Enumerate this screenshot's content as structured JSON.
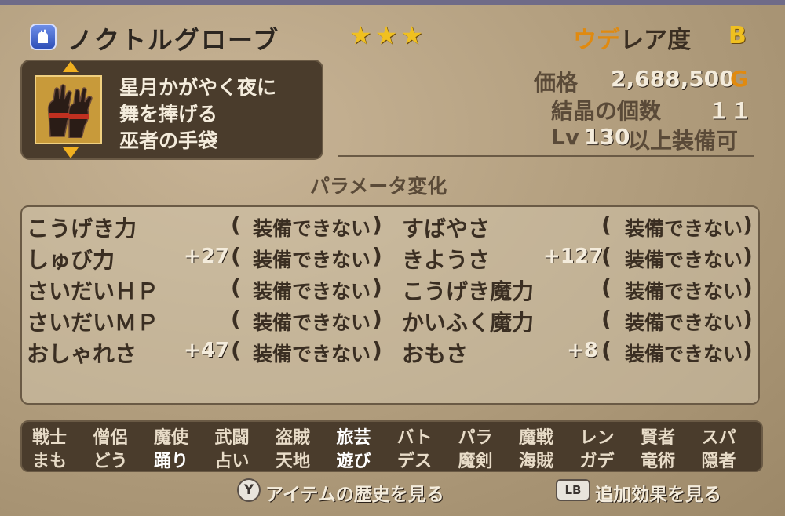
{
  "header": {
    "item_icon": "glove-icon",
    "item_name": "ノクトルグローブ",
    "stars": "★★★",
    "rarity_prefix": "ウデ",
    "rarity_label": "レア度",
    "rarity_grade": "B"
  },
  "description": {
    "lines": [
      "星月かがやく夜に",
      "舞を捧げる",
      "巫者の手袋"
    ]
  },
  "info": {
    "price_label": "価格",
    "price_value": "2,688,500",
    "price_unit": "G",
    "crystal_label": "結晶の個数",
    "crystal_value": "１１",
    "level_prefix": "Lv",
    "level_value": "130",
    "level_suffix": "以上装備可"
  },
  "params_title": "パラメータ変化",
  "params": {
    "left": [
      {
        "name": "こうげき力",
        "value": "",
        "status": "装備できない"
      },
      {
        "name": "しゅび力",
        "value": "+27",
        "status": "装備できない"
      },
      {
        "name": "さいだいＨＰ",
        "value": "",
        "status": "装備できない"
      },
      {
        "name": "さいだいＭＰ",
        "value": "",
        "status": "装備できない"
      },
      {
        "name": "おしゃれさ",
        "value": "+47",
        "status": "装備できない"
      }
    ],
    "right": [
      {
        "name": "すばやさ",
        "value": "",
        "status": "装備できない"
      },
      {
        "name": "きようさ",
        "value": "+127",
        "status": "装備できない"
      },
      {
        "name": "こうげき魔力",
        "value": "",
        "status": "装備できない"
      },
      {
        "name": "かいふく魔力",
        "value": "",
        "status": "装備できない"
      },
      {
        "name": "おもさ",
        "value": "+8",
        "status": "装備できない"
      }
    ]
  },
  "jobs": {
    "row1": [
      "戦士",
      "僧侶",
      "魔使",
      "武闘",
      "盗賊",
      "旅芸",
      "バト",
      "パラ",
      "魔戦",
      "レン",
      "賢者",
      "スパ"
    ],
    "row2": [
      "まも",
      "どう",
      "踊り",
      "占い",
      "天地",
      "遊び",
      "デス",
      "魔剣",
      "海賊",
      "ガデ",
      "竜術",
      "隠者"
    ],
    "row1_on": [
      false,
      false,
      false,
      false,
      false,
      true,
      false,
      false,
      false,
      false,
      false,
      false
    ],
    "row2_on": [
      false,
      false,
      true,
      false,
      false,
      true,
      false,
      false,
      false,
      false,
      false,
      false
    ]
  },
  "footer": {
    "y_button": "Y",
    "history_label": "アイテムの歴史を見る",
    "lb_button": "LB",
    "effect_label": "追加効果を見る"
  }
}
